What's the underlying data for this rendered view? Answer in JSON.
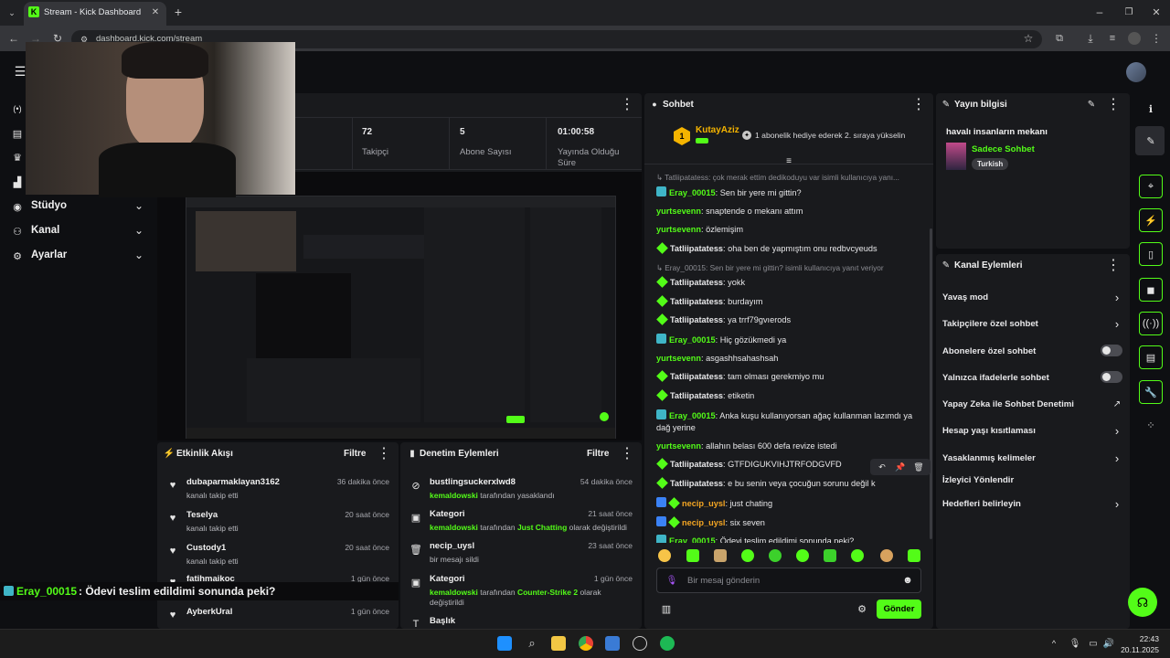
{
  "browser": {
    "tab_title": "Stream - Kick Dashboard",
    "tab_favicon": "K",
    "url": "dashboard.kick.com/stream"
  },
  "sidebar": {
    "items": [
      {
        "label": "Stüdyo",
        "icon": "studio-icon"
      },
      {
        "label": "Kanal",
        "icon": "channel-icon"
      },
      {
        "label": "Ayarlar",
        "icon": "gear-icon"
      }
    ]
  },
  "stats": [
    {
      "value": "72",
      "label": "Takipçi"
    },
    {
      "value": "5",
      "label": "Abone Sayısı"
    },
    {
      "value": "01:00:58",
      "label": "Yayında Olduğu Süre"
    }
  ],
  "activity_feed": {
    "title": "Etkinlik Akışı",
    "filter": "Filtre",
    "items": [
      {
        "name": "dubaparmaklayan3162",
        "sub": "kanalı takip etti",
        "time": "36 dakika önce"
      },
      {
        "name": "Teselya",
        "sub": "kanalı takip etti",
        "time": "20 saat önce"
      },
      {
        "name": "Custody1",
        "sub": "kanalı takip etti",
        "time": "20 saat önce"
      },
      {
        "name": "fatihmaikoc",
        "sub": "",
        "time": "1 gün önce"
      },
      {
        "name": "AyberkUral",
        "sub": "",
        "time": "1 gün önce"
      }
    ]
  },
  "mod_actions": {
    "title": "Denetim Eylemleri",
    "filter": "Filtre",
    "items": [
      {
        "title": "bustlingsuckerxlwd8",
        "actor": "kemaldowski",
        "text": "tarafından yasaklandı",
        "highlight": "",
        "text2": "",
        "time": "54 dakika önce"
      },
      {
        "title": "Kategori",
        "actor": "kemaldowski",
        "text": "tarafından",
        "highlight": "Just Chatting",
        "text2": "olarak değiştirildi",
        "time": "21 saat önce"
      },
      {
        "title": "necip_uysl",
        "actor": "",
        "text": "bir mesajı sildi",
        "highlight": "",
        "text2": "",
        "time": "23 saat önce"
      },
      {
        "title": "Kategori",
        "actor": "kemaldowski",
        "text": "tarafından",
        "highlight": "Counter-Strike 2",
        "text2": "olarak değiştirildi",
        "time": "1 gün önce"
      },
      {
        "title": "Başlık",
        "actor": "",
        "text": "",
        "highlight": "",
        "text2": "",
        "time": ""
      }
    ]
  },
  "overlay_chat": {
    "name": "Eray_00015",
    "text": ": Ödevi teslim edildimi sonunda peki?"
  },
  "chat": {
    "title": "Sohbet",
    "pinned_user": "KutayAziz",
    "pinned_badge": "1",
    "pinned_text": "1 abonelik hediye ederek 2. sıraya yükselin",
    "messages": [
      {
        "type": "reply",
        "text": "Tatliipatatess: çok merak ettim dedikoduyu var isimli kullanıcıya yanı..."
      },
      {
        "type": "msg",
        "badge": "og",
        "name": "Eray_00015",
        "color": "#53fc18",
        "text": "Sen bir yere mi gittin?"
      },
      {
        "type": "msg",
        "badge": "",
        "name": "yurtsevenn",
        "color": "#53fc18",
        "text": "snaptende o mekanı attım"
      },
      {
        "type": "msg",
        "badge": "",
        "name": "yurtsevenn",
        "color": "#53fc18",
        "text": "özlemişim"
      },
      {
        "type": "msg",
        "badge": "gem",
        "name": "Tatliipatatess",
        "color": "#e8e8ea",
        "text": "oha ben de yapmıştım onu redbvcyeuds"
      },
      {
        "type": "reply",
        "text": "Eray_00015: Sen bir yere mi gittin? isimli kullanıcıya yanıt veriyor"
      },
      {
        "type": "msg",
        "badge": "gem",
        "name": "Tatliipatatess",
        "color": "#e8e8ea",
        "text": "yokk"
      },
      {
        "type": "msg",
        "badge": "gem",
        "name": "Tatliipatatess",
        "color": "#e8e8ea",
        "text": "burdayım"
      },
      {
        "type": "msg",
        "badge": "gem",
        "name": "Tatliipatatess",
        "color": "#e8e8ea",
        "text": "ya trrf79gvıerods"
      },
      {
        "type": "msg",
        "badge": "og",
        "name": "Eray_00015",
        "color": "#53fc18",
        "text": "Hiç gözükmedi ya"
      },
      {
        "type": "msg",
        "badge": "",
        "name": "yurtsevenn",
        "color": "#53fc18",
        "text": "asgashhsahashsah"
      },
      {
        "type": "msg",
        "badge": "gem",
        "name": "Tatliipatatess",
        "color": "#e8e8ea",
        "text": "tam olması gerekmiyo mu"
      },
      {
        "type": "msg",
        "badge": "gem",
        "name": "Tatliipatatess",
        "color": "#e8e8ea",
        "text": "etiketin"
      },
      {
        "type": "msg2",
        "badge": "og",
        "name": "Eray_00015",
        "color": "#53fc18",
        "text": "Anka kuşu kullanıyorsan ağaç kullanman lazımdı ya dağ yerine"
      },
      {
        "type": "msg",
        "badge": "",
        "name": "yurtsevenn",
        "color": "#53fc18",
        "text": "allahın belası 600 defa revize istedi"
      },
      {
        "type": "msg",
        "badge": "gem",
        "name": "Tatliipatatess",
        "color": "#e8e8ea",
        "text": "GTFDIGUKVIHJTRFODGVFD"
      },
      {
        "type": "msg",
        "badge": "gem",
        "name": "Tatliipatatess",
        "color": "#e8e8ea",
        "text": "e bu senin veya çocuğun sorunu değil k"
      },
      {
        "type": "msg",
        "badge": "vipgem",
        "name": "necip_uysl",
        "color": "#f5a623",
        "text": "just chating"
      },
      {
        "type": "msg",
        "badge": "vipgem",
        "name": "necip_uysl",
        "color": "#f5a623",
        "text": "six seven"
      },
      {
        "type": "msg",
        "badge": "og",
        "name": "Eray_00015",
        "color": "#53fc18",
        "text": "Ödevi teslim edildimi sonunda peki?"
      }
    ],
    "input_placeholder": "Bir mesaj gönderin",
    "send_label": "Gönder"
  },
  "stream_info": {
    "title": "Yayın bilgisi",
    "stream_title": "havalı insanların mekanı",
    "category": "Sadece Sohbet",
    "tag": "Turkish"
  },
  "channel_actions": {
    "title": "Kanal Eylemleri",
    "items": [
      {
        "label": "Yavaş mod",
        "control": "chevron"
      },
      {
        "label": "Takipçilere özel sohbet",
        "control": "chevron"
      },
      {
        "label": "Abonelere özel sohbet",
        "control": "toggle"
      },
      {
        "label": "Yalnızca ifadelerle sohbet",
        "control": "toggle"
      },
      {
        "label": "Yapay Zeka ile Sohbet Denetimi",
        "control": "external"
      },
      {
        "label": "Hesap yaşı kısıtlaması",
        "control": "chevron"
      },
      {
        "label": "Yasaklanmış kelimeler",
        "control": "chevron"
      },
      {
        "label": "İzleyici Yönlendir",
        "control": "none"
      },
      {
        "label": "Hedefleri belirleyin",
        "control": "chevron"
      }
    ]
  },
  "taskbar": {
    "time": "22:43",
    "date": "20.11.2025"
  },
  "colors": {
    "accent": "#53fc18",
    "panel": "#191a1d",
    "bg": "#0e0f12"
  }
}
